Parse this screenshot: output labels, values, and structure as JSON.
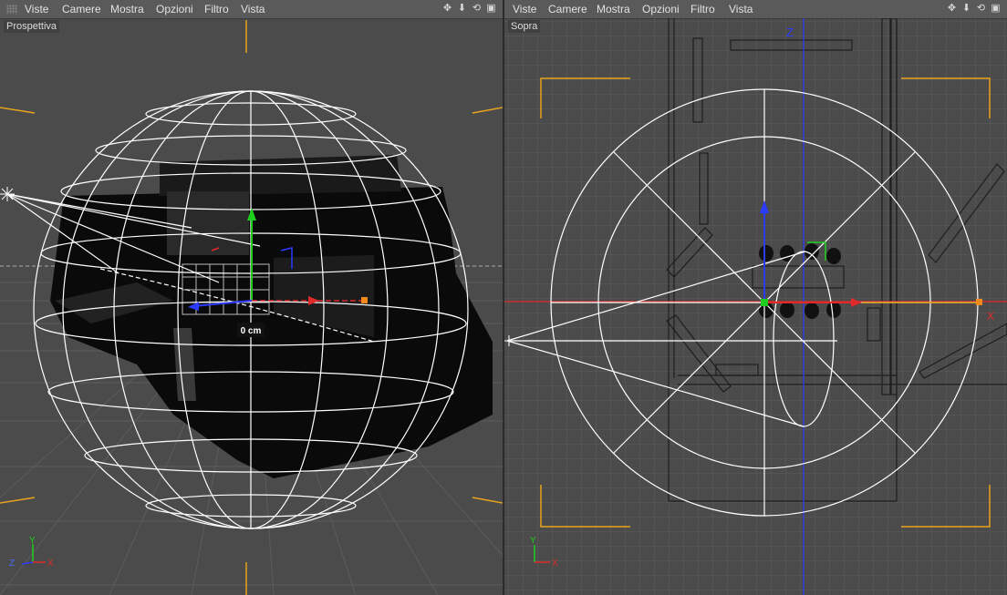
{
  "left_view": {
    "menu": [
      "Viste",
      "Camere",
      "Mostra",
      "Opzioni",
      "Filtro",
      "Vista"
    ],
    "tools": {
      "move": "move-icon",
      "down": "arrow-down-icon",
      "rotate": "rotate-icon",
      "maximize": "maximize-icon"
    },
    "label": "Prospettiva",
    "distance_label": "0 cm",
    "axes": {
      "y": "Y",
      "z": "Z",
      "x": "X"
    }
  },
  "right_view": {
    "menu": [
      "Viste",
      "Camere",
      "Mostra",
      "Opzioni",
      "Filtro",
      "Vista"
    ],
    "tools": {
      "move": "move-icon",
      "down": "arrow-down-icon",
      "rotate": "rotate-icon",
      "maximize": "maximize-icon"
    },
    "label": "Sopra",
    "z_label": "Z",
    "x_label": "X",
    "axes": {
      "y": "Y",
      "x": "X"
    }
  },
  "colors": {
    "background": "#4b4b4b",
    "grid": "#5a5a5a",
    "wire": "#ffffff",
    "safe_frame": "#e8a31c",
    "axis_x": "#e02a2a",
    "axis_y": "#1fcf1f",
    "axis_z": "#2b3bff"
  }
}
